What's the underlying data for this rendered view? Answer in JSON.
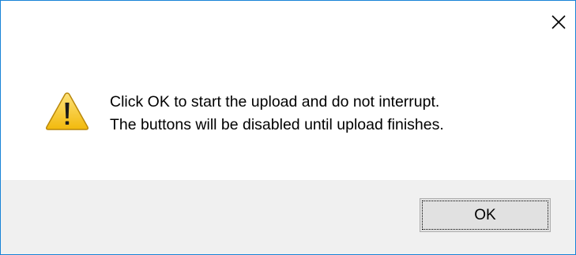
{
  "window": {
    "close_icon": "close-icon"
  },
  "message": {
    "icon": "warning-icon",
    "line1": "Click OK to start the upload and do not interrupt.",
    "line2": "The buttons will be disabled until upload finishes."
  },
  "buttons": {
    "ok_label": "OK"
  },
  "colors": {
    "border": "#1883d7",
    "footer_bg": "#f0f0f0",
    "button_bg": "#e1e1e1",
    "warning_fill": "#f5c518"
  }
}
